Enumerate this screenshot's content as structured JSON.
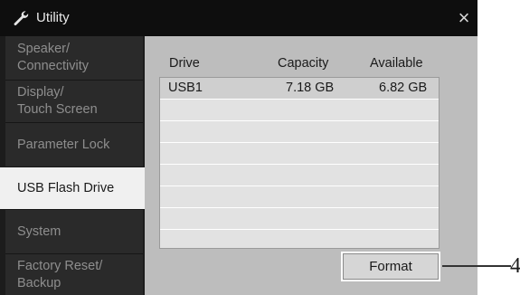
{
  "window": {
    "title": "Utility",
    "icon": "wrench-icon",
    "close_label": "×"
  },
  "sidebar": {
    "items": [
      {
        "line1": "Speaker/",
        "line2": "Connectivity",
        "active": false
      },
      {
        "line1": "Display/",
        "line2": "Touch Screen",
        "active": false
      },
      {
        "line1": "Parameter Lock",
        "line2": "",
        "active": false
      },
      {
        "line1": "USB Flash Drive",
        "line2": "",
        "active": true
      },
      {
        "line1": "System",
        "line2": "",
        "active": false
      },
      {
        "line1": "Factory Reset/",
        "line2": "Backup",
        "active": false
      }
    ]
  },
  "table": {
    "headers": {
      "drive": "Drive",
      "capacity": "Capacity",
      "available": "Available"
    },
    "rows": [
      {
        "drive": "USB1",
        "capacity": "7.18 GB",
        "available": "6.82 GB",
        "selected": true
      }
    ]
  },
  "format_button": {
    "label": "Format"
  },
  "callout": {
    "number": "4"
  },
  "colors": {
    "screen_bg": "#1c1c1c",
    "panel_bg": "#bdbdbd",
    "active_item_bg": "#f0f0f0",
    "list_bg": "#e2e2e2"
  }
}
